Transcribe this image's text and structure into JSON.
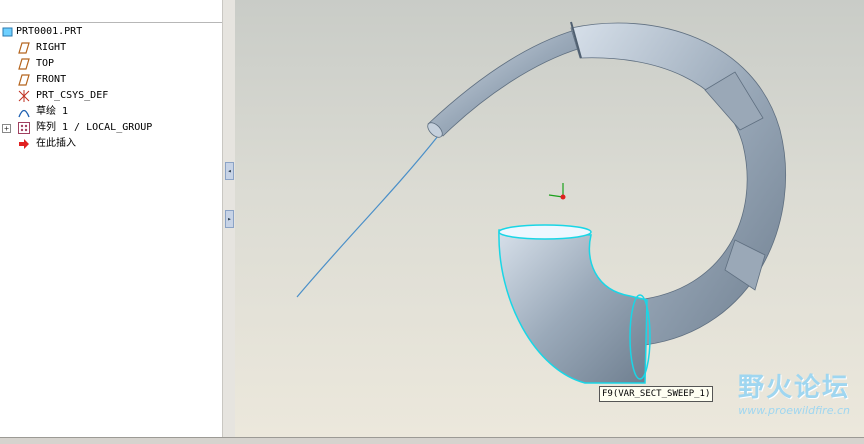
{
  "model_tree": {
    "items": [
      {
        "label": "PRT0001.PRT",
        "icon": "part-icon"
      },
      {
        "label": "RIGHT",
        "icon": "datum-plane-icon"
      },
      {
        "label": "TOP",
        "icon": "datum-plane-icon"
      },
      {
        "label": "FRONT",
        "icon": "datum-plane-icon"
      },
      {
        "label": "PRT_CSYS_DEF",
        "icon": "coordinate-system-icon"
      },
      {
        "label": "草绘 1",
        "icon": "sketch-icon"
      },
      {
        "label": "阵列 1 / LOCAL_GROUP",
        "icon": "pattern-icon",
        "expander": "+"
      },
      {
        "label": "在此插入",
        "icon": "insert-here-arrow-icon"
      }
    ]
  },
  "viewport": {
    "tooltip": "F9(VAR_SECT_SWEEP_1)"
  },
  "watermark": {
    "title": "野火论坛",
    "url": "www.proewildfire.cn"
  },
  "colors": {
    "accent_highlight": "#19d6e6",
    "datum_plane": "#b5651d",
    "sweep_surface": "#9aa9b9"
  }
}
